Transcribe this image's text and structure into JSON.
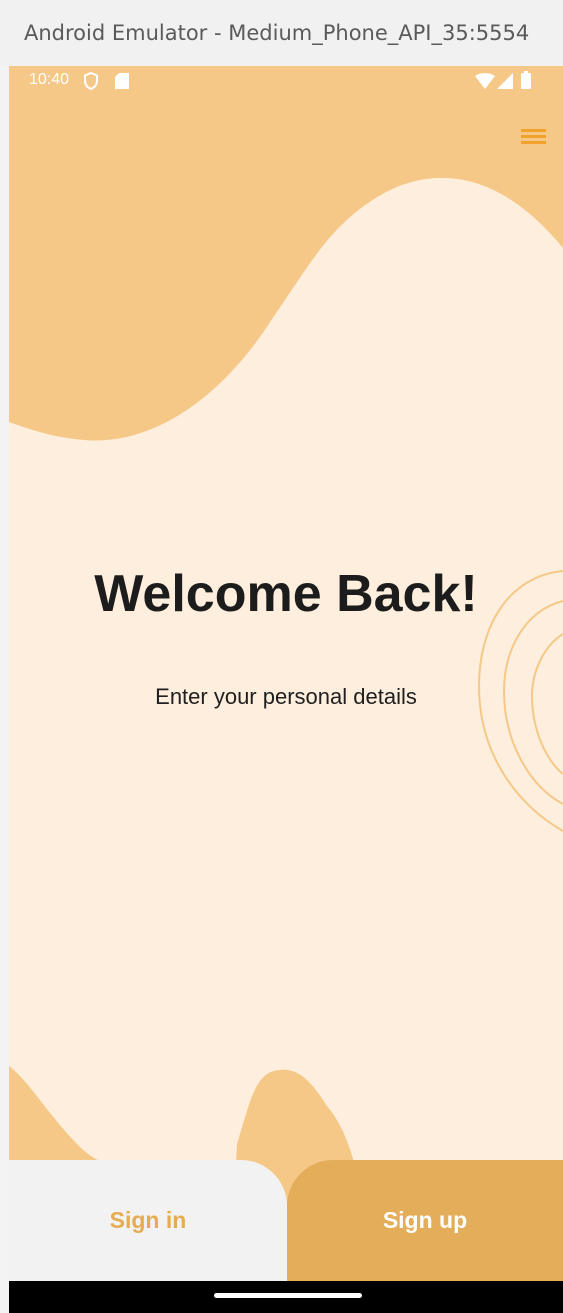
{
  "window": {
    "title": "Android Emulator - Medium_Phone_API_35:5554"
  },
  "status_bar": {
    "time": "10:40",
    "icons": [
      "shield-icon",
      "sd-card-icon",
      "wifi-icon",
      "signal-icon",
      "battery-icon"
    ]
  },
  "header": {
    "menu_icon": "hamburger-menu-icon"
  },
  "main": {
    "title": "Welcome Back!",
    "subtitle": "Enter your personal details"
  },
  "actions": {
    "sign_in_label": "Sign in",
    "sign_up_label": "Sign up"
  },
  "theme": {
    "background": "#fdeedd",
    "blob": "#f5c887",
    "accent": "#f0a22d",
    "sign_in_text": "#e5ac52",
    "sign_up_bg": "#e4ad5a"
  }
}
